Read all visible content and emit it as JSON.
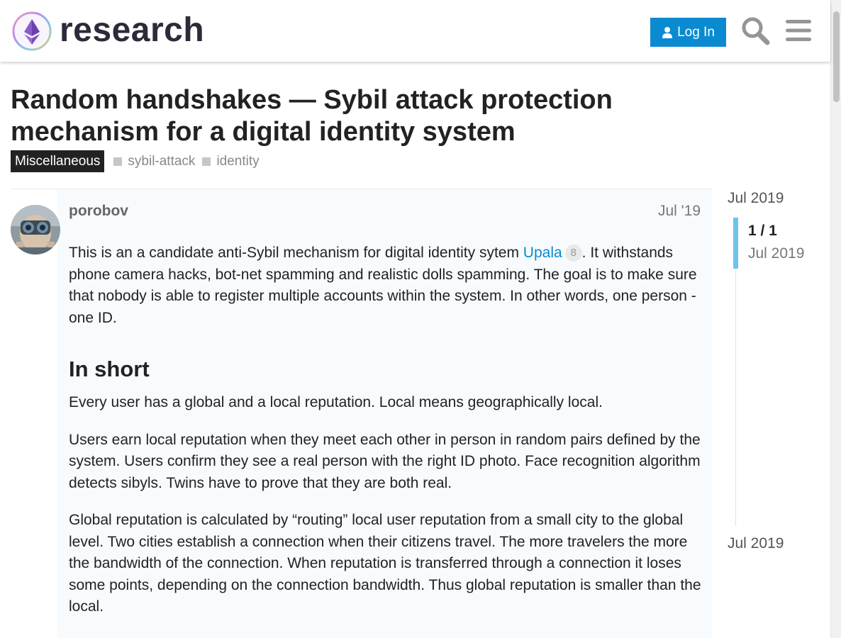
{
  "header": {
    "brand": "research",
    "login_label": "Log In"
  },
  "topic": {
    "title": "Random handshakes — Sybil attack protection mechanism for a digital identity system",
    "category": "Miscellaneous",
    "tags": [
      "sybil-attack",
      "identity"
    ]
  },
  "post": {
    "username": "porobov",
    "date": "Jul '19",
    "intro_before_link": "This is an a candidate anti-Sybil mechanism for digital identity sytem ",
    "link_text": "Upala",
    "link_count": "8",
    "intro_after_link": ". It withstands phone camera hacks, bot-net spamming and realistic dolls spamming. The goal is to make sure that nobody is able to register multiple accounts within the system. In other words, one person - one ID.",
    "heading": "In short",
    "paragraphs": [
      "Every user has a global and a local reputation. Local means geographically local.",
      "Users earn local reputation when they meet each other in person in random pairs defined by the system. Users confirm they see a real person with the right ID photo. Face recognition algorithm detects sibyls. Twins have to prove that they are both real.",
      "Global reputation is calculated by “routing” local user reputation from a small city to the global level. Two cities establish a connection when their citizens travel. The more travelers the more the bandwidth of the connection. When reputation is transferred through a connection it loses some points, depending on the connection bandwidth. Thus global reputation is smaller than the local."
    ]
  },
  "timeline": {
    "start_date": "Jul 2019",
    "position": "1 / 1",
    "position_date": "Jul 2019",
    "end_date": "Jul 2019"
  },
  "colors": {
    "accent": "#0a8ad0",
    "timeline_handle": "#6ec3ee",
    "category_bg": "#222222"
  }
}
